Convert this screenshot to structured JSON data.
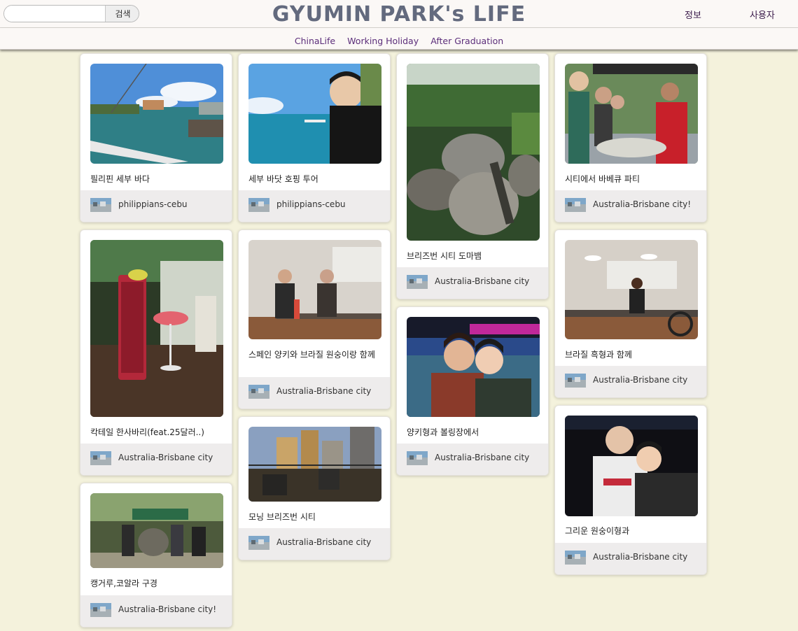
{
  "search": {
    "placeholder": "",
    "value": "",
    "button_label": "검색"
  },
  "header": {
    "title": "GYUMIN PARK's LIFE",
    "info_link": "정보",
    "user_link": "사용자"
  },
  "nav": {
    "items": [
      "ChinaLife",
      "Working Holiday",
      "After Graduation"
    ]
  },
  "colors": {
    "page_background": "#f4f2dc",
    "title": "#636a7e",
    "nav_link": "#5b2d7a",
    "card_footer": "#eeecec"
  },
  "posts": [
    {
      "title": "필리핀 세부 바다",
      "category": "philippians-cebu",
      "photo": "sea-boat-photo"
    },
    {
      "title": "칵테일 한사바리(feat.25달러..)",
      "category": "Australia-Brisbane city",
      "photo": "cocktail-photo"
    },
    {
      "title": "캥거루,코알라 구경",
      "category": "Australia-Brisbane city!",
      "photo": "zoo-group-photo"
    },
    {
      "title": "세부 바닷 호핑 투어",
      "category": "philippians-cebu",
      "photo": "sea-selfie-photo"
    },
    {
      "title": "스페인 양키와 브라질 원숭이랑 함께",
      "category": "Australia-Brisbane city",
      "photo": "kitchen-friends-photo"
    },
    {
      "title": "모닝 브리즈번 시티",
      "category": "Australia-Brisbane city",
      "photo": "city-balcony-photo"
    },
    {
      "title": "브리즈번 시티 도마뱀",
      "category": "Australia-Brisbane city",
      "photo": "lizard-rocks-photo"
    },
    {
      "title": "양키형과 볼링장에서",
      "category": "Australia-Brisbane city",
      "photo": "bowling-selfie-photo"
    },
    {
      "title": "시티에서 바베큐 파티",
      "category": "Australia-Brisbane city!",
      "photo": "bbq-party-photo"
    },
    {
      "title": "브라질 흑형과 함께",
      "category": "Australia-Brisbane city",
      "photo": "kitchen-night-photo"
    },
    {
      "title": "그리운 원숭이형과",
      "category": "Australia-Brisbane city",
      "photo": "night-selfie-photo"
    }
  ]
}
